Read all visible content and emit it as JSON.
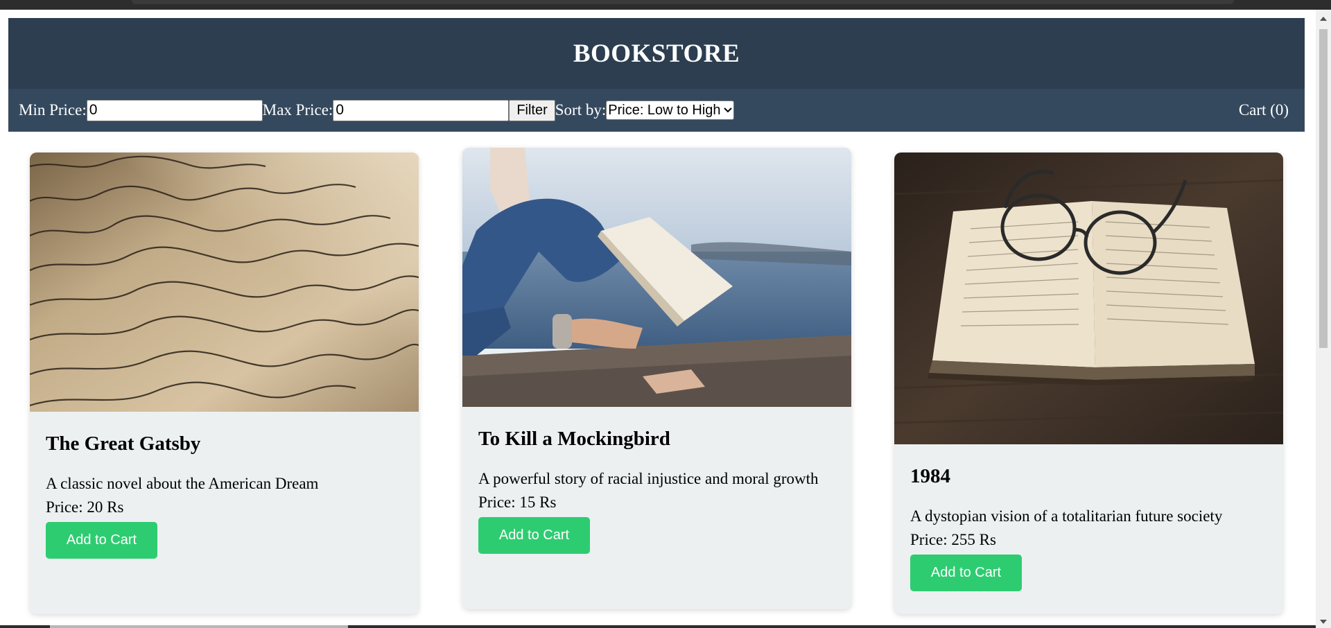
{
  "header": {
    "title": "BOOKSTORE"
  },
  "toolbar": {
    "min_price_label": "Min Price:",
    "min_price_value": "0",
    "max_price_label": "Max Price:",
    "max_price_value": "0",
    "filter_label": "Filter",
    "sort_label": "Sort by:",
    "sort_selected": "Price: Low to High",
    "cart_label": "Cart (0)"
  },
  "books": [
    {
      "title": "The Great Gatsby",
      "description": "A classic novel about the American Dream",
      "price": "Price: 20 Rs",
      "button": "Add to Cart",
      "image": "handwritten-letter-photo"
    },
    {
      "title": "To Kill a Mockingbird",
      "description": "A powerful story of racial injustice and moral growth",
      "price": "Price: 15 Rs",
      "button": "Add to Cart",
      "image": "person-reading-by-water-photo"
    },
    {
      "title": "1984",
      "description": "A dystopian vision of a totalitarian future society",
      "price": "Price: 255 Rs",
      "button": "Add to Cart",
      "image": "open-book-with-glasses-photo"
    }
  ],
  "colors": {
    "header_bg": "#2c3e50",
    "toolbar_bg": "#34495e",
    "card_bg": "#ecf0f1",
    "button_bg": "#2ecc71"
  }
}
